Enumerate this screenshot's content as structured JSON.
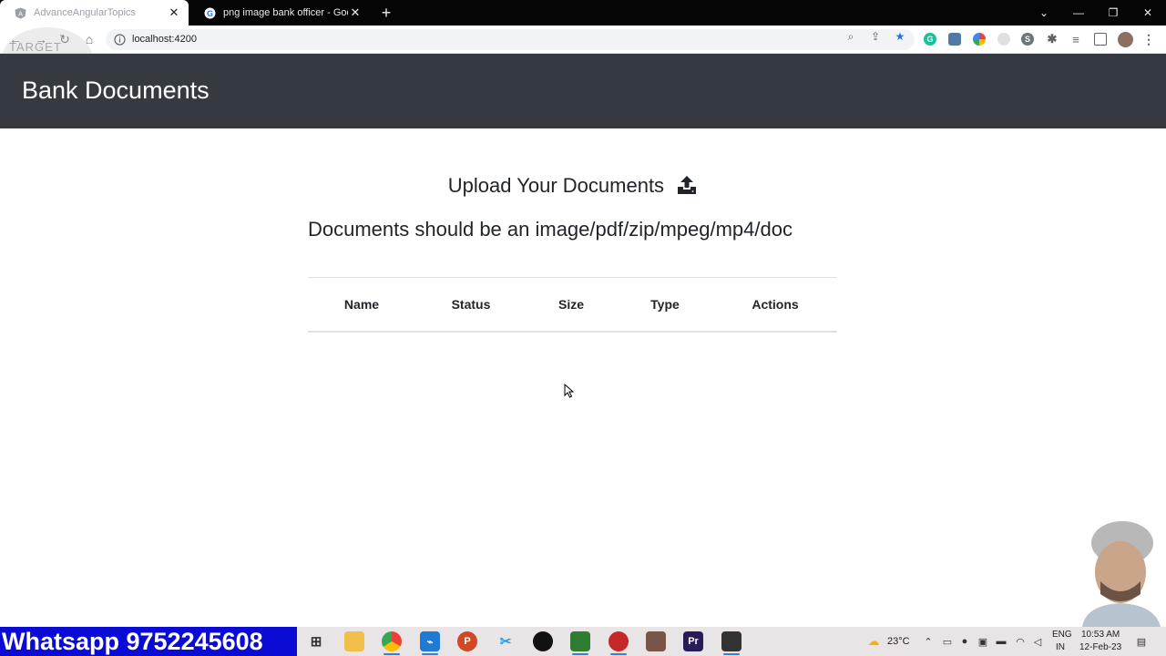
{
  "browser": {
    "tabs": [
      {
        "title": "AdvanceAngularTopics",
        "active": true
      },
      {
        "title": "png image bank officer - Google",
        "active": false
      }
    ],
    "new_tab": "+",
    "url": "localhost:4200",
    "window_controls": {
      "dropdown": "⌄",
      "minimize": "—",
      "restore": "❐",
      "close": "✕"
    }
  },
  "watermark": {
    "text": "TARGET"
  },
  "app": {
    "title": "Bank Documents",
    "upload_heading": "Upload Your Documents",
    "subtitle": "Documents should be an image/pdf/zip/mpeg/mp4/doc",
    "table": {
      "headers": [
        "Name",
        "Status",
        "Size",
        "Type",
        "Actions"
      ],
      "rows": []
    }
  },
  "taskbar": {
    "banner": "Whatsapp 9752245608",
    "weather": "23°C",
    "language": "ENG",
    "region": "IN",
    "time": "10:53 AM",
    "date": "12-Feb-23"
  },
  "colors": {
    "header_bg": "#343a40",
    "banner_bg": "#0b0bd6",
    "table_border": "#dee2e6"
  }
}
